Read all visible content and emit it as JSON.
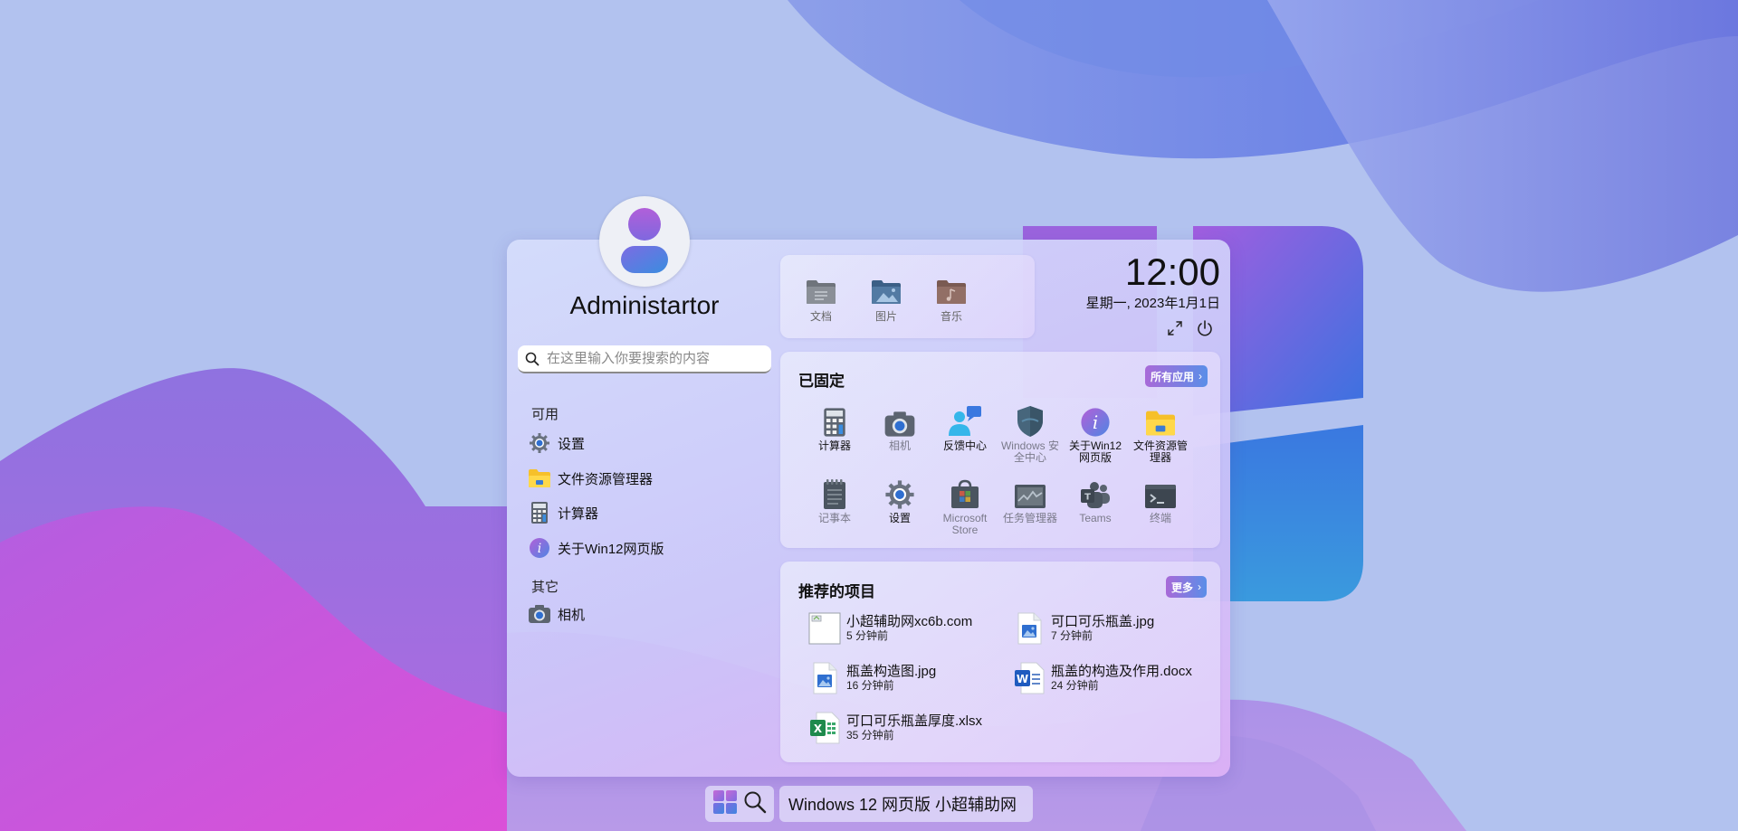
{
  "user": {
    "name": "Administartor",
    "avatar_icon": "user-avatar-icon"
  },
  "search": {
    "placeholder": "在这里输入你要搜索的内容"
  },
  "left": {
    "available_label": "可用",
    "available": [
      {
        "label": "设置",
        "icon": "settings-gear-icon"
      },
      {
        "label": "文件资源管理器",
        "icon": "folder-icon"
      },
      {
        "label": "计算器",
        "icon": "calculator-icon"
      },
      {
        "label": "关于Win12网页版",
        "icon": "info-icon"
      }
    ],
    "other_label": "其它",
    "other": [
      {
        "label": "相机",
        "icon": "camera-icon"
      }
    ]
  },
  "favorites": [
    {
      "label": "文档",
      "icon": "documents-folder-icon"
    },
    {
      "label": "图片",
      "icon": "pictures-folder-icon"
    },
    {
      "label": "音乐",
      "icon": "music-folder-icon"
    }
  ],
  "clock": {
    "time": "12:00",
    "date": "星期一, 2023年1月1日"
  },
  "pinned": {
    "title": "已固定",
    "all_apps_label": "所有应用",
    "items": [
      {
        "label": "计算器",
        "icon": "calculator-icon",
        "dim": false
      },
      {
        "label": "相机",
        "icon": "camera-icon",
        "dim": true
      },
      {
        "label": "反馈中心",
        "icon": "feedback-icon",
        "dim": false
      },
      {
        "label": "Windows 安全中心",
        "icon": "shield-icon",
        "dim": true
      },
      {
        "label": "关于Win12 网页版",
        "icon": "info-icon",
        "dim": false
      },
      {
        "label": "文件资源管理器",
        "icon": "folder-icon",
        "dim": false
      },
      {
        "label": "记事本",
        "icon": "notepad-icon",
        "dim": true
      },
      {
        "label": "设置",
        "icon": "settings-gear-icon",
        "dim": false
      },
      {
        "label": "Microsoft Store",
        "icon": "store-icon",
        "dim": true
      },
      {
        "label": "任务管理器",
        "icon": "task-manager-icon",
        "dim": true
      },
      {
        "label": "Teams",
        "icon": "teams-icon",
        "dim": true
      },
      {
        "label": "终端",
        "icon": "terminal-icon",
        "dim": true
      }
    ]
  },
  "recommended": {
    "title": "推荐的项目",
    "more_label": "更多",
    "items": [
      {
        "name": "小超辅助网xc6b.com",
        "time": "5 分钟前",
        "icon": "broken-image-icon"
      },
      {
        "name": "可口可乐瓶盖.jpg",
        "time": "7 分钟前",
        "icon": "image-file-icon"
      },
      {
        "name": "瓶盖构造图.jpg",
        "time": "16 分钟前",
        "icon": "image-file-icon"
      },
      {
        "name": "瓶盖的构造及作用.docx",
        "time": "24 分钟前",
        "icon": "word-file-icon"
      },
      {
        "name": "可口可乐瓶盖厚度.xlsx",
        "time": "35 分钟前",
        "icon": "excel-file-icon"
      }
    ]
  },
  "taskbar": {
    "label": "Windows 12 网页版 小超辅助网"
  }
}
